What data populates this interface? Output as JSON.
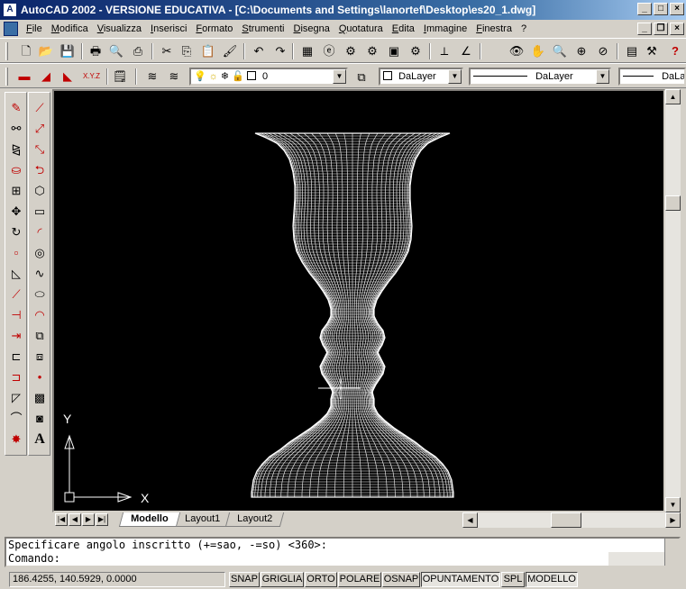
{
  "window": {
    "title": "AutoCAD 2002 - VERSIONE EDUCATIVA - [C:\\Documents and Settings\\lanortef\\Desktop\\es20_1.dwg]",
    "app_icon": "autocad-logo-icon"
  },
  "menu": [
    "File",
    "Modifica",
    "Visualizza",
    "Inserisci",
    "Formato",
    "Strumenti",
    "Disegna",
    "Quotatura",
    "Edita",
    "Immagine",
    "Finestra",
    "?"
  ],
  "layer_toolbar": {
    "layer_value": "0",
    "color_value": "DaLayer",
    "linetype_value": "DaLayer",
    "lineweight_value": "DaLa"
  },
  "ucs": {
    "x_label": "X",
    "y_label": "Y"
  },
  "tabs": [
    {
      "label": "Modello",
      "active": true
    },
    {
      "label": "Layout1",
      "active": false
    },
    {
      "label": "Layout2",
      "active": false
    }
  ],
  "command": {
    "history": "Specificare angolo inscritto (+=sao, -=so) <360>:",
    "prompt": "Comando:"
  },
  "status": {
    "coordinates": "186.4255, 140.5929, 0.0000",
    "buttons": [
      {
        "label": "SNAP",
        "on": false
      },
      {
        "label": "GRIGLIA",
        "on": false
      },
      {
        "label": "ORTO",
        "on": false
      },
      {
        "label": "POLARE",
        "on": false
      },
      {
        "label": "OSNAP",
        "on": false
      },
      {
        "label": "OPUNTAMENTO",
        "on": true
      },
      {
        "label": "SPL",
        "on": false
      },
      {
        "label": "MODELLO",
        "on": true
      }
    ]
  },
  "colors": {
    "canvas": "#000000",
    "wire": "#ffffff",
    "titlebar": "#0a246a"
  }
}
